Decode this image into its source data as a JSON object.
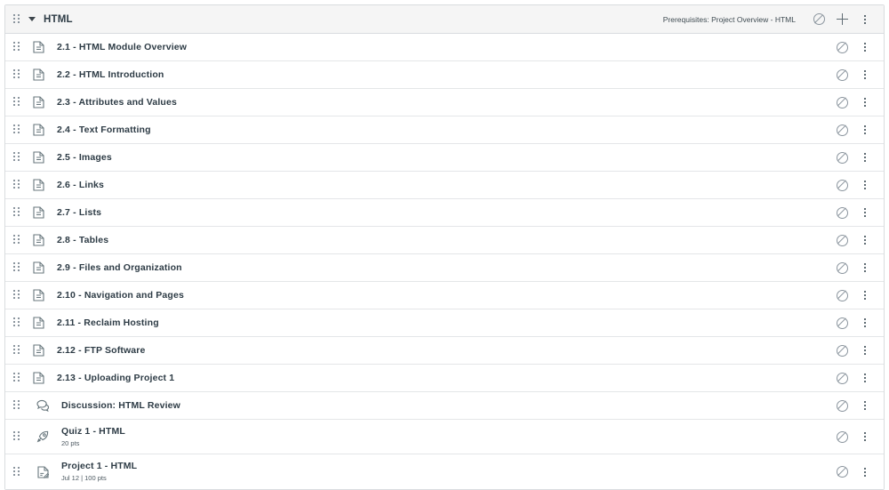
{
  "module": {
    "title": "HTML",
    "prerequisites": "Prerequisites: Project Overview - HTML",
    "collapse_icon": "chevron-down-icon",
    "drag_icon": "drag-handle-icon",
    "publish_icon": "unpublished-circle-slash-icon",
    "add_icon": "plus-icon",
    "menu_icon": "kebab-menu-icon",
    "colors": {
      "header_bg": "#f5f5f5",
      "border": "#d9dcdf",
      "row_border": "#e4e6e8",
      "text": "#2d3b45",
      "icon": "#68777d",
      "muted": "#8b959e"
    }
  },
  "items": [
    {
      "title": "2.1 - HTML Module Overview",
      "sub": "",
      "icon": "page-document-icon",
      "type": "page",
      "indented": false,
      "tall": false
    },
    {
      "title": "2.2 - HTML Introduction",
      "sub": "",
      "icon": "page-document-icon",
      "type": "page",
      "indented": false,
      "tall": false
    },
    {
      "title": "2.3 - Attributes and Values",
      "sub": "",
      "icon": "page-document-icon",
      "type": "page",
      "indented": false,
      "tall": false
    },
    {
      "title": "2.4 - Text Formatting",
      "sub": "",
      "icon": "page-document-icon",
      "type": "page",
      "indented": false,
      "tall": false
    },
    {
      "title": "2.5 - Images",
      "sub": "",
      "icon": "page-document-icon",
      "type": "page",
      "indented": false,
      "tall": false
    },
    {
      "title": "2.6 - Links",
      "sub": "",
      "icon": "page-document-icon",
      "type": "page",
      "indented": false,
      "tall": false
    },
    {
      "title": "2.7 - Lists",
      "sub": "",
      "icon": "page-document-icon",
      "type": "page",
      "indented": false,
      "tall": false
    },
    {
      "title": "2.8 - Tables",
      "sub": "",
      "icon": "page-document-icon",
      "type": "page",
      "indented": false,
      "tall": false
    },
    {
      "title": "2.9 - Files and Organization",
      "sub": "",
      "icon": "page-document-icon",
      "type": "page",
      "indented": false,
      "tall": false
    },
    {
      "title": "2.10 - Navigation and Pages",
      "sub": "",
      "icon": "page-document-icon",
      "type": "page",
      "indented": false,
      "tall": false
    },
    {
      "title": "2.11 - Reclaim Hosting",
      "sub": "",
      "icon": "page-document-icon",
      "type": "page",
      "indented": false,
      "tall": false
    },
    {
      "title": "2.12 - FTP Software",
      "sub": "",
      "icon": "page-document-icon",
      "type": "page",
      "indented": false,
      "tall": false
    },
    {
      "title": "2.13 - Uploading Project 1",
      "sub": "",
      "icon": "page-document-icon",
      "type": "page",
      "indented": false,
      "tall": false
    },
    {
      "title": "Discussion: HTML Review",
      "sub": "",
      "icon": "discussion-bubble-icon",
      "type": "discussion",
      "indented": true,
      "tall": false
    },
    {
      "title": "Quiz 1 - HTML",
      "sub": "20 pts",
      "icon": "quiz-rocket-icon",
      "type": "quiz",
      "indented": true,
      "tall": true
    },
    {
      "title": "Project 1 - HTML",
      "sub": "Jul 12 | 100 pts",
      "icon": "assignment-clipboard-icon",
      "type": "assignment",
      "indented": true,
      "tall": true
    }
  ]
}
